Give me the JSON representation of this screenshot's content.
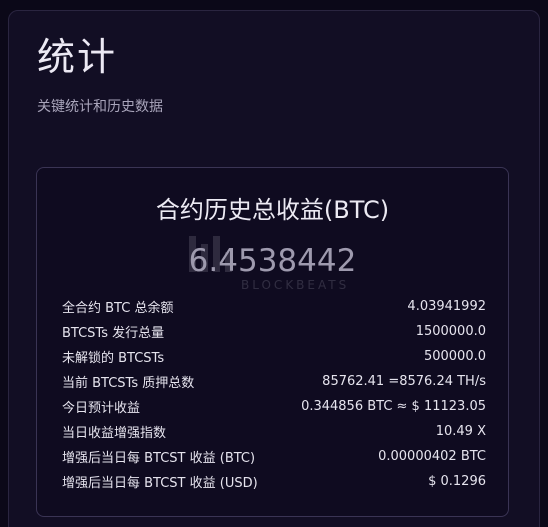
{
  "header": {
    "title": "统计",
    "subtitle": "关键统计和历史数据"
  },
  "card": {
    "title": "合约历史总收益(BTC)",
    "total_value": "6.4538442",
    "watermark": "BLOCKBEATS",
    "rows": [
      {
        "label": "全合约 BTC 总余额",
        "value": "4.03941992"
      },
      {
        "label": "BTCSTs 发行总量",
        "value": "1500000.0"
      },
      {
        "label": "未解锁的 BTCSTs",
        "value": "500000.0"
      },
      {
        "label": "当前 BTCSTs 质押总数",
        "value": "85762.41 =8576.24 TH/s"
      },
      {
        "label": "今日预计收益",
        "value": "0.344856 BTC ≈ $ 11123.05"
      },
      {
        "label": "当日收益增强指数",
        "value": "10.49 X"
      },
      {
        "label": "增强后当日每 BTCST 收益 (BTC)",
        "value": "0.00000402 BTC"
      },
      {
        "label": "增强后当日每 BTCST 收益 (USD)",
        "value": "$ 0.1296"
      }
    ]
  }
}
